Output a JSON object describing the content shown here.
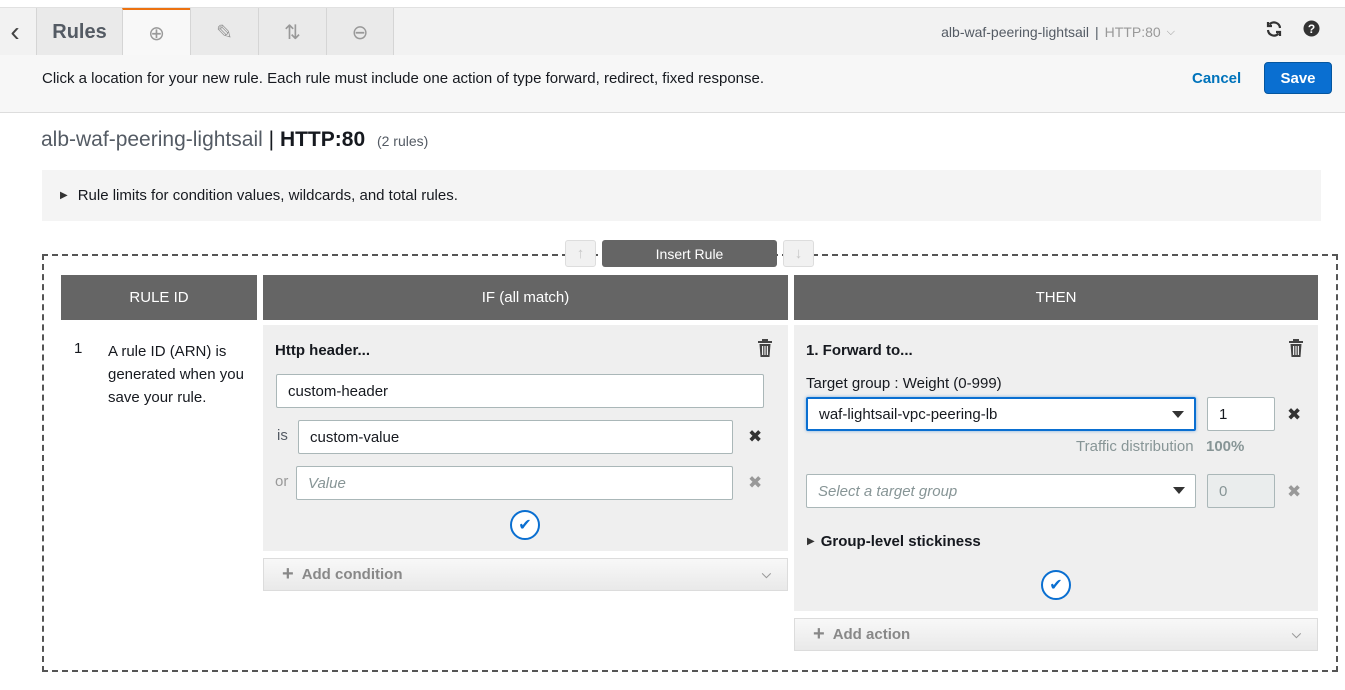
{
  "toolbar": {
    "back_icon": "chevron-left-icon",
    "title": "Rules",
    "tabs": [
      {
        "icon": "plus-circle-icon",
        "glyph": "⊕"
      },
      {
        "icon": "pencil-icon",
        "glyph": "✎"
      },
      {
        "icon": "reorder-icon",
        "glyph": "⇅"
      },
      {
        "icon": "minus-circle-icon",
        "glyph": "⊖"
      }
    ],
    "listener_name": "alb-waf-peering-lightsail",
    "separator": "|",
    "listener_port": "HTTP:80",
    "refresh_icon": "refresh-icon",
    "help_icon": "help-icon"
  },
  "instruction": {
    "text": "Click a location for your new rule. Each rule must include one action of type forward, redirect, fixed response.",
    "cancel_label": "Cancel",
    "save_label": "Save"
  },
  "heading": {
    "name": "alb-waf-peering-lightsail",
    "separator": "|",
    "port": "HTTP:80",
    "count": "(2 rules)"
  },
  "limits": {
    "label": "Rule limits for condition values, wildcards, and total rules."
  },
  "insert_rule_label": "Insert Rule",
  "columns": {
    "rule_id": "RULE ID",
    "if": "IF (all match)",
    "then": "THEN"
  },
  "rule": {
    "number": "1",
    "description": "A rule ID (ARN) is generated when you save your rule.",
    "condition": {
      "title": "Http header...",
      "header_name": "custom-header",
      "is_label": "is",
      "value": "custom-value",
      "or_label": "or",
      "value_placeholder": "Value",
      "add_label": "Add condition"
    },
    "action": {
      "title": "1. Forward to...",
      "target_label": "Target group : Weight (0-999)",
      "target_group": "waf-lightsail-vpc-peering-lb",
      "weight": "1",
      "traffic_label": "Traffic distribution",
      "traffic_value": "100%",
      "target_placeholder": "Select a target group",
      "weight_placeholder": "0",
      "stickiness_label": "Group-level stickiness",
      "add_label": "Add action"
    }
  }
}
